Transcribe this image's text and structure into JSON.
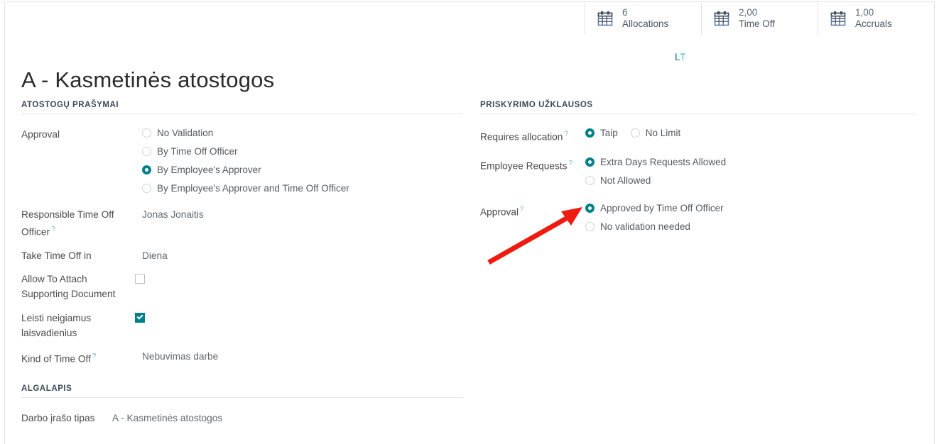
{
  "statbar": {
    "buttons": [
      {
        "icon": "calendar-icon",
        "value": "6",
        "label": "Allocations"
      },
      {
        "icon": "calendar-icon",
        "value": "2,00",
        "label": "Time Off"
      },
      {
        "icon": "calendar-icon",
        "value": "1,00",
        "label": "Accruals"
      }
    ]
  },
  "header": {
    "title": "A - Kasmetinės atostogos",
    "language_badge_part1": "L",
    "language_badge_part2": "T"
  },
  "left": {
    "section_title": "ATOSTOGŲ PRAŠYMAI",
    "approval": {
      "label": "Approval",
      "options": [
        {
          "label": "No Validation",
          "selected": false
        },
        {
          "label": "By Time Off Officer",
          "selected": false
        },
        {
          "label": "By Employee's Approver",
          "selected": true
        },
        {
          "label": "By Employee's Approver and Time Off Officer",
          "selected": false
        }
      ]
    },
    "responsible_officer": {
      "label": "Responsible Time Off Officer",
      "help": "?",
      "value": "Jonas Jonaitis"
    },
    "take_time_off_in": {
      "label": "Take Time Off in",
      "value": "Diena"
    },
    "allow_attach": {
      "label": "Allow To Attach Supporting Document",
      "checked": false
    },
    "leisti_neigiamus": {
      "label": "Leisti neigiamus laisvadienius",
      "checked": true
    },
    "kind_of_time_off": {
      "label": "Kind of Time Off",
      "help": "?",
      "value": "Nebuvimas darbe"
    }
  },
  "left_bottom": {
    "section_title": "ALGALAPIS",
    "work_entry_type": {
      "label": "Darbo įrašo tipas",
      "value": "A - Kasmetinės atostogos"
    }
  },
  "right": {
    "section_title": "PRISKYRIMO UŽKLAUSOS",
    "requires_allocation": {
      "label": "Requires allocation",
      "help": "?",
      "options": [
        {
          "label": "Taip",
          "selected": true
        },
        {
          "label": "No Limit",
          "selected": false
        }
      ]
    },
    "employee_requests": {
      "label": "Employee Requests",
      "help": "?",
      "options": [
        {
          "label": "Extra Days Requests Allowed",
          "selected": true
        },
        {
          "label": "Not Allowed",
          "selected": false
        }
      ]
    },
    "approval": {
      "label": "Approval",
      "help": "?",
      "options": [
        {
          "label": "Approved by Time Off Officer",
          "selected": true
        },
        {
          "label": "No validation needed",
          "selected": false
        }
      ]
    }
  },
  "annotation": {
    "arrow_color": "#ee1b11"
  },
  "colors": {
    "accent_teal": "#00818a",
    "border_gray": "#dfe1e6",
    "text_dark": "#2b2b2b",
    "help_blue": "#7bb8d4"
  }
}
